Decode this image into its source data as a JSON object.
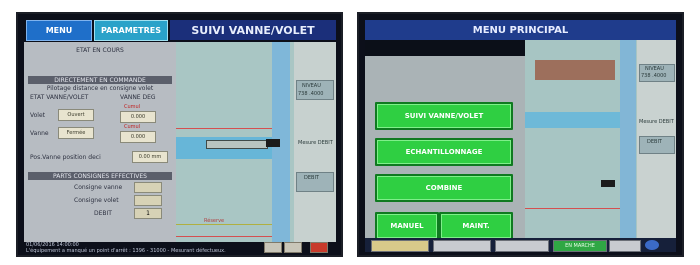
{
  "left_screen": {
    "tabs": {
      "menu": "MENU",
      "parametres": "PARAMETRES"
    },
    "title": "SUIVI VANNE/VOLET",
    "panel": {
      "header": "ETAT EN COURS",
      "section1": "DIRECTEMENT EN COMMANDE",
      "section1_note": "Pilotage distance en consigne volet",
      "cols": {
        "left": "ETAT VANNE/VOLET",
        "right": "VANNE DEG"
      },
      "rows": [
        {
          "label": "Volet",
          "value": "Ouvert"
        },
        {
          "label": "Vanne",
          "value": "Fermée"
        }
      ],
      "side_values": [
        "0.000",
        "0.000"
      ],
      "side_labels": [
        "Cumul",
        "Cumul"
      ],
      "deb_label": "Pos.Vanne position deci",
      "deb_value": "0.00 mm",
      "section2": "PARTS CONSIGNES EFFECTIVES",
      "section2_rows": [
        "Consigne vanne",
        "Consigne volet",
        "DEBIT"
      ],
      "section2_value": "1"
    },
    "scene": {
      "top_label": "NIVEAU",
      "top_value": "738 .4000",
      "mid_label": "Mesure DEBIT",
      "low_label": "DEBIT",
      "red_label": "Réserve"
    },
    "footer": {
      "date": "01/06/2016 14:00:00",
      "message": "L'équipement a manqué un point d'arrêt : 1396 - 31000 - Mesurant défectueux."
    }
  },
  "right_screen": {
    "title": "MENU PRINCIPAL",
    "buttons": [
      "SUIVI VANNE/VOLET",
      "ECHANTILLONNAGE",
      "COMBINE",
      "MANUEL",
      "MAINT."
    ],
    "scene": {
      "top_label": "NIVEAU",
      "top_value": "738 .4000",
      "mid_label": "Mesure DEBIT",
      "low_label": "DEBIT"
    },
    "footer_key_green": "EN MARCHE"
  }
}
